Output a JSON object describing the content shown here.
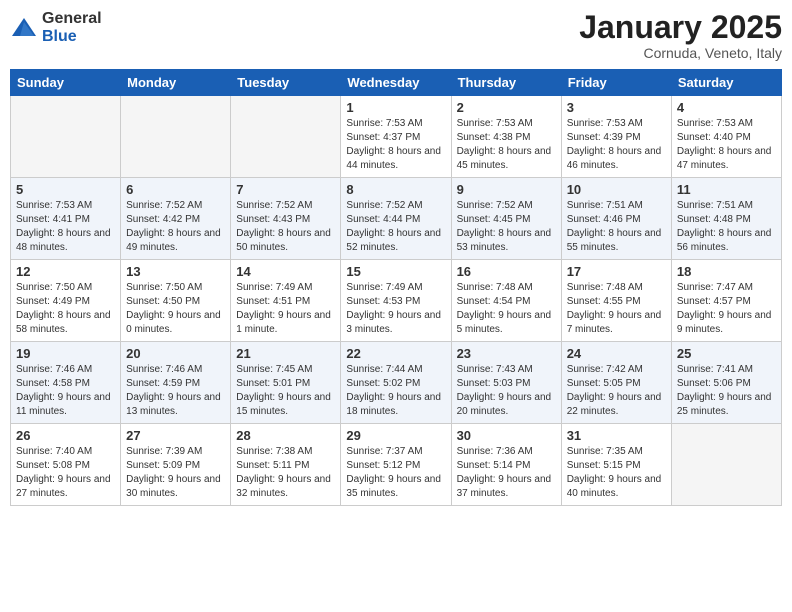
{
  "logo": {
    "general": "General",
    "blue": "Blue"
  },
  "title": "January 2025",
  "subtitle": "Cornuda, Veneto, Italy",
  "weekdays": [
    "Sunday",
    "Monday",
    "Tuesday",
    "Wednesday",
    "Thursday",
    "Friday",
    "Saturday"
  ],
  "weeks": [
    [
      {
        "day": "",
        "info": ""
      },
      {
        "day": "",
        "info": ""
      },
      {
        "day": "",
        "info": ""
      },
      {
        "day": "1",
        "info": "Sunrise: 7:53 AM\nSunset: 4:37 PM\nDaylight: 8 hours and 44 minutes."
      },
      {
        "day": "2",
        "info": "Sunrise: 7:53 AM\nSunset: 4:38 PM\nDaylight: 8 hours and 45 minutes."
      },
      {
        "day": "3",
        "info": "Sunrise: 7:53 AM\nSunset: 4:39 PM\nDaylight: 8 hours and 46 minutes."
      },
      {
        "day": "4",
        "info": "Sunrise: 7:53 AM\nSunset: 4:40 PM\nDaylight: 8 hours and 47 minutes."
      }
    ],
    [
      {
        "day": "5",
        "info": "Sunrise: 7:53 AM\nSunset: 4:41 PM\nDaylight: 8 hours and 48 minutes."
      },
      {
        "day": "6",
        "info": "Sunrise: 7:52 AM\nSunset: 4:42 PM\nDaylight: 8 hours and 49 minutes."
      },
      {
        "day": "7",
        "info": "Sunrise: 7:52 AM\nSunset: 4:43 PM\nDaylight: 8 hours and 50 minutes."
      },
      {
        "day": "8",
        "info": "Sunrise: 7:52 AM\nSunset: 4:44 PM\nDaylight: 8 hours and 52 minutes."
      },
      {
        "day": "9",
        "info": "Sunrise: 7:52 AM\nSunset: 4:45 PM\nDaylight: 8 hours and 53 minutes."
      },
      {
        "day": "10",
        "info": "Sunrise: 7:51 AM\nSunset: 4:46 PM\nDaylight: 8 hours and 55 minutes."
      },
      {
        "day": "11",
        "info": "Sunrise: 7:51 AM\nSunset: 4:48 PM\nDaylight: 8 hours and 56 minutes."
      }
    ],
    [
      {
        "day": "12",
        "info": "Sunrise: 7:50 AM\nSunset: 4:49 PM\nDaylight: 8 hours and 58 minutes."
      },
      {
        "day": "13",
        "info": "Sunrise: 7:50 AM\nSunset: 4:50 PM\nDaylight: 9 hours and 0 minutes."
      },
      {
        "day": "14",
        "info": "Sunrise: 7:49 AM\nSunset: 4:51 PM\nDaylight: 9 hours and 1 minute."
      },
      {
        "day": "15",
        "info": "Sunrise: 7:49 AM\nSunset: 4:53 PM\nDaylight: 9 hours and 3 minutes."
      },
      {
        "day": "16",
        "info": "Sunrise: 7:48 AM\nSunset: 4:54 PM\nDaylight: 9 hours and 5 minutes."
      },
      {
        "day": "17",
        "info": "Sunrise: 7:48 AM\nSunset: 4:55 PM\nDaylight: 9 hours and 7 minutes."
      },
      {
        "day": "18",
        "info": "Sunrise: 7:47 AM\nSunset: 4:57 PM\nDaylight: 9 hours and 9 minutes."
      }
    ],
    [
      {
        "day": "19",
        "info": "Sunrise: 7:46 AM\nSunset: 4:58 PM\nDaylight: 9 hours and 11 minutes."
      },
      {
        "day": "20",
        "info": "Sunrise: 7:46 AM\nSunset: 4:59 PM\nDaylight: 9 hours and 13 minutes."
      },
      {
        "day": "21",
        "info": "Sunrise: 7:45 AM\nSunset: 5:01 PM\nDaylight: 9 hours and 15 minutes."
      },
      {
        "day": "22",
        "info": "Sunrise: 7:44 AM\nSunset: 5:02 PM\nDaylight: 9 hours and 18 minutes."
      },
      {
        "day": "23",
        "info": "Sunrise: 7:43 AM\nSunset: 5:03 PM\nDaylight: 9 hours and 20 minutes."
      },
      {
        "day": "24",
        "info": "Sunrise: 7:42 AM\nSunset: 5:05 PM\nDaylight: 9 hours and 22 minutes."
      },
      {
        "day": "25",
        "info": "Sunrise: 7:41 AM\nSunset: 5:06 PM\nDaylight: 9 hours and 25 minutes."
      }
    ],
    [
      {
        "day": "26",
        "info": "Sunrise: 7:40 AM\nSunset: 5:08 PM\nDaylight: 9 hours and 27 minutes."
      },
      {
        "day": "27",
        "info": "Sunrise: 7:39 AM\nSunset: 5:09 PM\nDaylight: 9 hours and 30 minutes."
      },
      {
        "day": "28",
        "info": "Sunrise: 7:38 AM\nSunset: 5:11 PM\nDaylight: 9 hours and 32 minutes."
      },
      {
        "day": "29",
        "info": "Sunrise: 7:37 AM\nSunset: 5:12 PM\nDaylight: 9 hours and 35 minutes."
      },
      {
        "day": "30",
        "info": "Sunrise: 7:36 AM\nSunset: 5:14 PM\nDaylight: 9 hours and 37 minutes."
      },
      {
        "day": "31",
        "info": "Sunrise: 7:35 AM\nSunset: 5:15 PM\nDaylight: 9 hours and 40 minutes."
      },
      {
        "day": "",
        "info": ""
      }
    ]
  ]
}
